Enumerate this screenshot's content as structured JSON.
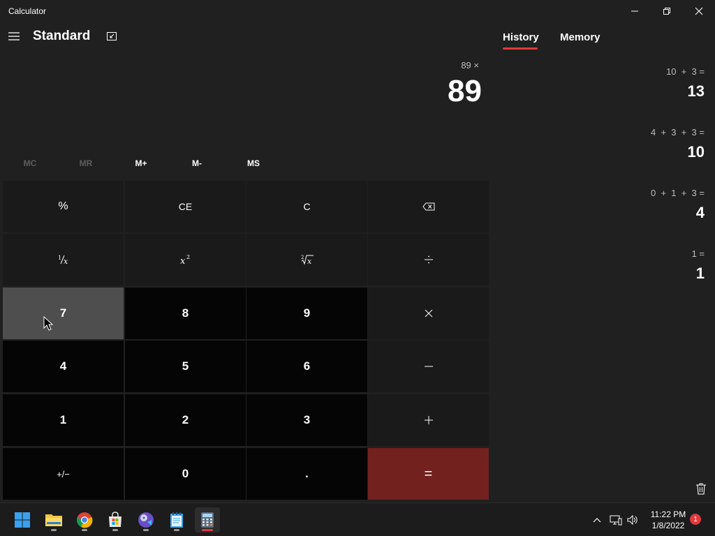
{
  "window": {
    "title": "Calculator"
  },
  "header": {
    "mode": "Standard"
  },
  "display": {
    "expression": "89 ×",
    "value": "89"
  },
  "memory": {
    "mc": "MC",
    "mr": "MR",
    "mplus": "M+",
    "mminus": "M-",
    "ms": "MS"
  },
  "keys": {
    "percent": "%",
    "ce": "CE",
    "c": "C",
    "k7": "7",
    "k8": "8",
    "k9": "9",
    "k4": "4",
    "k5": "5",
    "k6": "6",
    "k1": "1",
    "k2": "2",
    "k3": "3",
    "negate": "+/−",
    "k0": "0",
    "decimal": ".",
    "equals": "="
  },
  "side_panel": {
    "tabs": [
      "History",
      "Memory"
    ],
    "history": [
      {
        "expression": "10  +  3 =",
        "result": "13"
      },
      {
        "expression": "4  +  3  +  3 =",
        "result": "10"
      },
      {
        "expression": "0  +  1  +  3 =",
        "result": "4"
      },
      {
        "expression": "1 =",
        "result": "1"
      }
    ]
  },
  "taskbar": {
    "time": "11:22 PM",
    "date": "1/8/2022",
    "notifications": "1"
  },
  "colors": {
    "accent": "#e3383c",
    "equals": "#73211e",
    "background": "#202020"
  }
}
